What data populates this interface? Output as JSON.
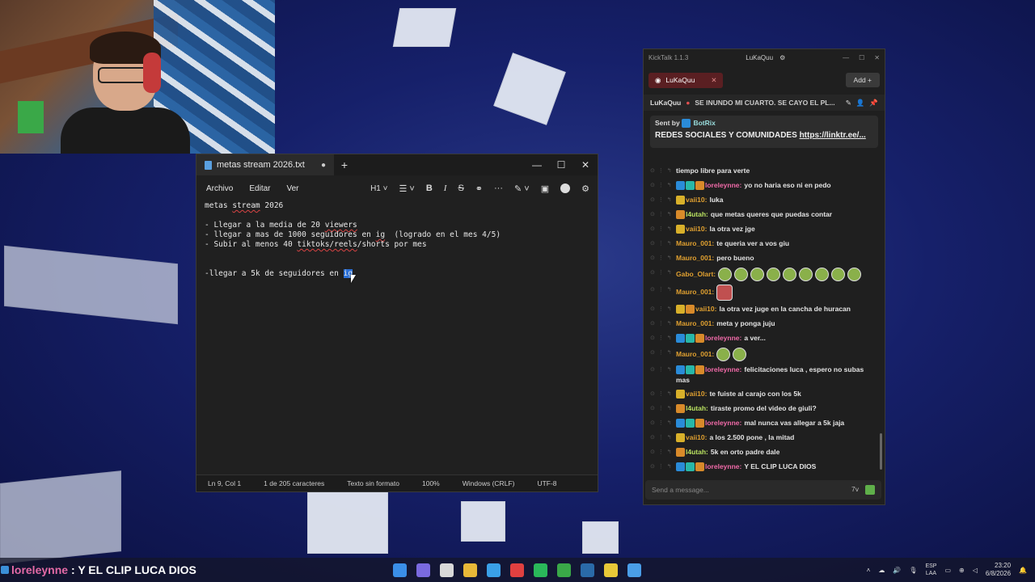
{
  "notepad": {
    "tab_title": "metas stream 2026.txt",
    "menu": [
      "Archivo",
      "Editar",
      "Ver"
    ],
    "heading_tool": "H1",
    "lines": [
      {
        "parts": [
          {
            "t": "metas "
          },
          {
            "t": "stream",
            "sq": true
          },
          {
            "t": " 2026"
          }
        ]
      },
      {
        "parts": [
          {
            "t": ""
          }
        ]
      },
      {
        "parts": [
          {
            "t": "- Llegar a la media de 20 "
          },
          {
            "t": "viewers",
            "sq": true
          }
        ]
      },
      {
        "parts": [
          {
            "t": "- llegar a mas de 1000 seguidores en "
          },
          {
            "t": "ig",
            "sq": true
          },
          {
            "t": "  (logrado en el mes 4/5)"
          }
        ]
      },
      {
        "parts": [
          {
            "t": "- Subir al menos 40 "
          },
          {
            "t": "tiktoks/reels",
            "sq": true
          },
          {
            "t": "/shorts por mes"
          }
        ]
      },
      {
        "parts": [
          {
            "t": ""
          }
        ]
      },
      {
        "parts": [
          {
            "t": ""
          }
        ]
      },
      {
        "parts": [
          {
            "t": "-llegar a 5k de seguidores en "
          },
          {
            "t": "ig",
            "sel": true
          }
        ]
      }
    ],
    "status": {
      "position": "Ln 9, Col 1",
      "chars": "1 de 205 caracteres",
      "format": "Texto sin formato",
      "zoom": "100%",
      "eol": "Windows (CRLF)",
      "encoding": "UTF-8"
    }
  },
  "chat": {
    "app_title": "KickTalk 1.1.3",
    "account": "LuKaQuu",
    "tab_label": "LuKaQuu",
    "add_label": "Add",
    "channel": "LuKaQuu",
    "stream_title": "SE INUNDO MI CUARTO. SE CAYO EL PL...",
    "pinned_sent_by": "Sent by",
    "pinned_bot": "BotRix",
    "pinned_text": "REDES SOCIALES Y COMUNIDADES",
    "pinned_link": "https://linktr.ee/...",
    "input_placeholder": "Send a message...",
    "messages": [
      {
        "user": "",
        "text": "tiempo libre para verte",
        "color": "#f06aa8",
        "badges": []
      },
      {
        "user": "loreleynne:",
        "text": "yo no haria eso ni en pedo",
        "color": "#f06aa8",
        "badges": [
          "b-blue",
          "b-teal",
          "b-orange"
        ]
      },
      {
        "user": "vaii10:",
        "text": "luka",
        "color": "#e0a030",
        "badges": [
          "b-gold"
        ]
      },
      {
        "user": "l4utah:",
        "text": "que metas queres que puedas contar",
        "color": "#b8e060",
        "badges": [
          "b-orange"
        ]
      },
      {
        "user": "vaii10:",
        "text": "la otra vez jge",
        "color": "#e0a030",
        "badges": [
          "b-gold"
        ]
      },
      {
        "user": "Mauro_001:",
        "text": "te queria ver a vos giu",
        "color": "#e0a030",
        "badges": []
      },
      {
        "user": "Mauro_001:",
        "text": "pero bueno",
        "color": "#e0a030",
        "badges": []
      },
      {
        "user": "Gabo_Olart:",
        "text": "",
        "color": "#e0a030",
        "badges": [],
        "emotes": 9
      },
      {
        "user": "Mauro_001:",
        "text": "",
        "color": "#e0a030",
        "badges": [],
        "bigemote": true
      },
      {
        "user": "vaii10:",
        "text": "la otra vez juge en la cancha de huracan",
        "color": "#e0a030",
        "badges": [
          "b-gold",
          "b-orange"
        ]
      },
      {
        "user": "Mauro_001:",
        "text": "meta y ponga juju",
        "color": "#e0a030",
        "badges": []
      },
      {
        "user": "loreleynne:",
        "text": "a ver...",
        "color": "#f06aa8",
        "badges": [
          "b-blue",
          "b-teal",
          "b-orange"
        ]
      },
      {
        "user": "Mauro_001:",
        "text": "",
        "color": "#e0a030",
        "badges": [],
        "emotes": 2
      },
      {
        "user": "loreleynne:",
        "text": "felicitaciones luca , espero no subas mas",
        "color": "#f06aa8",
        "badges": [
          "b-blue",
          "b-teal",
          "b-orange"
        ]
      },
      {
        "user": "vaii10:",
        "text": "te fuiste al carajo con los 5k",
        "color": "#e0a030",
        "badges": [
          "b-gold"
        ]
      },
      {
        "user": "l4utah:",
        "text": "tiraste promo del video de giuli?",
        "color": "#b8e060",
        "badges": [
          "b-orange"
        ]
      },
      {
        "user": "loreleynne:",
        "text": "mal nunca vas allegar a 5k jaja",
        "color": "#f06aa8",
        "badges": [
          "b-blue",
          "b-teal",
          "b-orange"
        ]
      },
      {
        "user": "vaii10:",
        "text": "a los 2.500 pone , la mitad",
        "color": "#e0a030",
        "badges": [
          "b-gold"
        ]
      },
      {
        "user": "l4utah:",
        "text": "5k en orto padre dale",
        "color": "#b8e060",
        "badges": [
          "b-orange"
        ]
      },
      {
        "user": "loreleynne:",
        "text": "Y EL CLIP LUCA DIOS",
        "color": "#f06aa8",
        "badges": [
          "b-blue",
          "b-teal",
          "b-orange"
        ]
      }
    ]
  },
  "overlay": {
    "user": "loreleynne",
    "text": ": Y EL CLIP LUCA DIOS"
  },
  "taskbar": {
    "lang_top": "ESP",
    "lang_bottom": "LAA",
    "time": "23:20",
    "date": "6/8/2026",
    "icon_colors": [
      "#3a8ee8",
      "#7a6ae0",
      "#d8d8d8",
      "#e8b838",
      "#3aa0e8",
      "#e04040",
      "#2ab85a",
      "#3aa848",
      "#2a6aa8",
      "#e8c838",
      "#4a9ee8"
    ]
  }
}
